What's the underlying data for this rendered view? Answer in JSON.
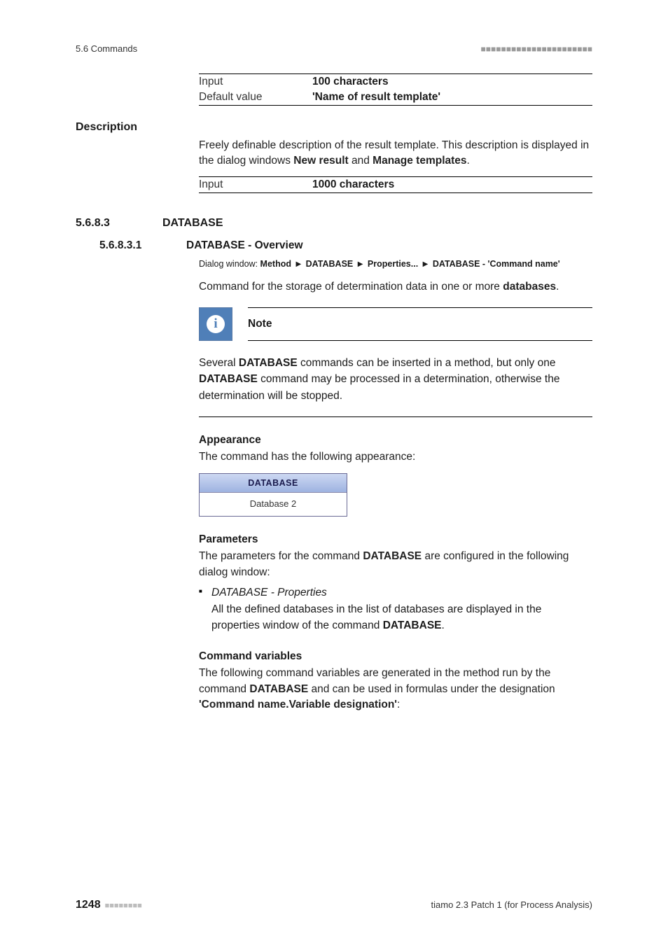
{
  "header": {
    "left": "5.6 Commands",
    "bars": "■■■■■■■■■■■■■■■■■■■■■■"
  },
  "table1": {
    "input_key": "Input",
    "input_val": "100 characters",
    "default_key": "Default value",
    "default_val": "'Name of result template'"
  },
  "desc": {
    "heading": "Description",
    "para": "Freely definable description of the result template. This description is displayed in the dialog windows ",
    "bold1": "New result",
    "mid": " and ",
    "bold2": "Manage templates",
    "end": "."
  },
  "table2": {
    "input_key": "Input",
    "input_val": "1000 characters"
  },
  "sec": {
    "num1": "5.6.8.3",
    "title1": "DATABASE",
    "num2": "5.6.8.3.1",
    "title2": "DATABASE - Overview"
  },
  "dialog": {
    "prefix": "Dialog window: ",
    "p1": "Method",
    "p2": "DATABASE",
    "p3": "Properties...",
    "p4": "DATABASE - 'Command name'"
  },
  "cmdIntro": {
    "pre": "Command for the storage of determination data in one or more ",
    "bold": "databases",
    "post": "."
  },
  "note": {
    "title": "Note",
    "b1": "Several ",
    "bold1": "DATABASE",
    "b2": " commands can be inserted in a method, but only one ",
    "bold2": "DATABASE",
    "b3": " command may be processed in a determination, otherwise the determination will be stopped."
  },
  "appearance": {
    "h": "Appearance",
    "p": "The command has the following appearance:"
  },
  "cmdbox": {
    "title": "DATABASE",
    "body": "Database 2"
  },
  "params": {
    "h": "Parameters",
    "p_pre": "The parameters for the command ",
    "p_bold": "DATABASE",
    "p_post": " are configured in the following dialog window:",
    "li_title": "DATABASE - Properties",
    "li_body_pre": "All the defined databases in the list of databases are displayed in the properties window of the command ",
    "li_body_bold": "DATABASE",
    "li_body_post": "."
  },
  "cmdvars": {
    "h": "Command variables",
    "p_pre": "The following command variables are generated in the method run by the command ",
    "p_bold": "DATABASE",
    "p_mid": " and can be used in formulas under the designation ",
    "p_bold2": "'Command name.Variable designation'",
    "p_post": ":"
  },
  "footer": {
    "page": "1248",
    "bars": "■■■■■■■■",
    "right": "tiamo 2.3 Patch 1 (for Process Analysis)"
  }
}
